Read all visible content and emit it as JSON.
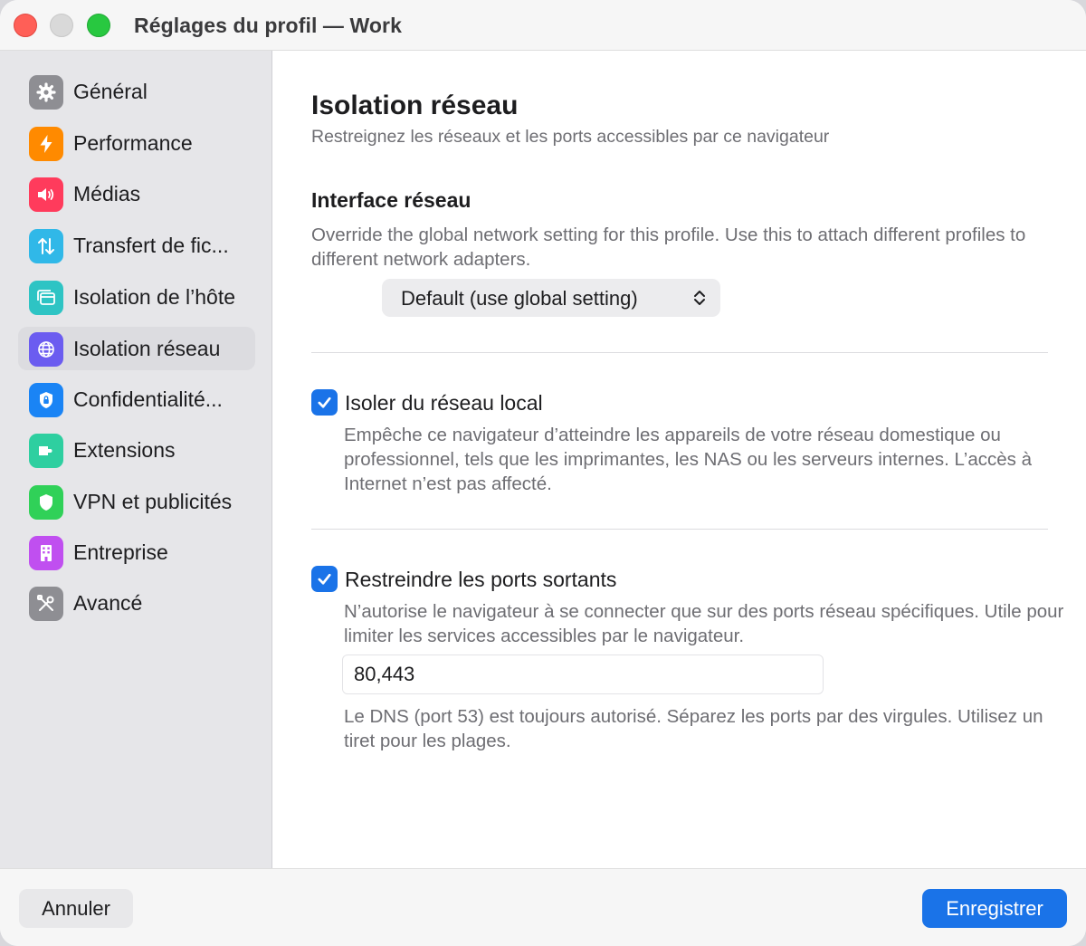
{
  "window": {
    "title": "Réglages du profil — Work"
  },
  "sidebar": {
    "items": [
      {
        "label": "Général",
        "icon": "gear-icon",
        "color": "#8e8e93"
      },
      {
        "label": "Performance",
        "icon": "bolt-icon",
        "color": "#ff8a00"
      },
      {
        "label": "Médias",
        "icon": "speaker-icon",
        "color": "#ff3b5c"
      },
      {
        "label": "Transfert de fic...",
        "icon": "transfer-arrows-icon",
        "color": "#30b8e8"
      },
      {
        "label": "Isolation de l’hôte",
        "icon": "window-icon",
        "color": "#2ec4c4"
      },
      {
        "label": "Isolation réseau",
        "icon": "globe-icon",
        "color": "#6b5cf0",
        "active": true
      },
      {
        "label": "Confidentialité...",
        "icon": "lock-icon",
        "color": "#1a84f5"
      },
      {
        "label": "Extensions",
        "icon": "puzzle-icon",
        "color": "#2ecfa0"
      },
      {
        "label": "VPN et publicités",
        "icon": "shield-icon",
        "color": "#30d158"
      },
      {
        "label": "Entreprise",
        "icon": "building-icon",
        "color": "#c04ff0"
      },
      {
        "label": "Avancé",
        "icon": "tools-icon",
        "color": "#8e8e93"
      }
    ]
  },
  "main": {
    "title": "Isolation réseau",
    "subtitle": "Restreignez les réseaux et les ports accessibles par ce navigateur",
    "interface": {
      "heading": "Interface réseau",
      "description": "Override the global network setting for this profile. Use this to attach different profiles to different network adapters.",
      "selected": "Default (use global setting)"
    },
    "isolate_local": {
      "checked": true,
      "label": "Isoler du réseau local",
      "description": "Empêche ce navigateur d’atteindre les appareils de votre réseau domestique ou professionnel, tels que les imprimantes, les NAS ou les serveurs internes. L’accès à Internet n’est pas affecté."
    },
    "restrict_ports": {
      "checked": true,
      "label": "Restreindre les ports sortants",
      "description": "N’autorise le navigateur à se connecter que sur des ports réseau spécifiques. Utile pour limiter les services accessibles par le navigateur.",
      "ports_value": "80,443",
      "hint": "Le DNS (port 53) est toujours autorisé. Séparez les ports par des virgules. Utilisez un tiret pour les plages."
    }
  },
  "footer": {
    "cancel_label": "Annuler",
    "save_label": "Enregistrer"
  },
  "colors": {
    "accent": "#1a73e8"
  }
}
